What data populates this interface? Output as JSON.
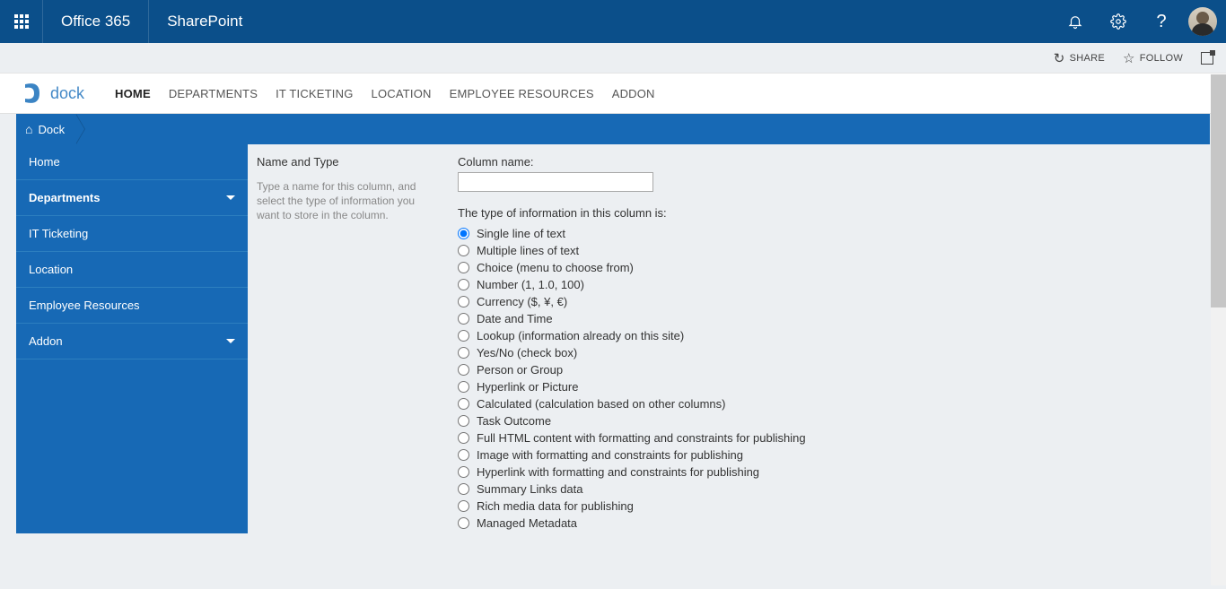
{
  "suite": {
    "office": "Office 365",
    "app": "SharePoint"
  },
  "actions": {
    "share": "SHARE",
    "follow": "FOLLOW"
  },
  "site": {
    "logo_text": "dock",
    "nav": [
      {
        "label": "HOME",
        "active": true
      },
      {
        "label": "DEPARTMENTS",
        "active": false
      },
      {
        "label": "IT TICKETING",
        "active": false
      },
      {
        "label": "LOCATION",
        "active": false
      },
      {
        "label": "EMPLOYEE RESOURCES",
        "active": false
      },
      {
        "label": "ADDON",
        "active": false
      }
    ],
    "crumb": "Dock"
  },
  "leftnav": [
    {
      "label": "Home",
      "expandable": false
    },
    {
      "label": "Departments",
      "expandable": true,
      "selected": true
    },
    {
      "label": "IT Ticketing",
      "expandable": false
    },
    {
      "label": "Location",
      "expandable": false
    },
    {
      "label": "Employee Resources",
      "expandable": false
    },
    {
      "label": "Addon",
      "expandable": true
    }
  ],
  "form": {
    "section_title": "Name and Type",
    "section_desc": "Type a name for this column, and select the type of information you want to store in the column.",
    "column_name_label": "Column name:",
    "column_name_value": "",
    "type_heading": "The type of information in this column is:",
    "types": [
      "Single line of text",
      "Multiple lines of text",
      "Choice (menu to choose from)",
      "Number (1, 1.0, 100)",
      "Currency ($, ¥, €)",
      "Date and Time",
      "Lookup (information already on this site)",
      "Yes/No (check box)",
      "Person or Group",
      "Hyperlink or Picture",
      "Calculated (calculation based on other columns)",
      "Task Outcome",
      "Full HTML content with formatting and constraints for publishing",
      "Image with formatting and constraints for publishing",
      "Hyperlink with formatting and constraints for publishing",
      "Summary Links data",
      "Rich media data for publishing",
      "Managed Metadata"
    ],
    "selected_type_index": 0
  }
}
